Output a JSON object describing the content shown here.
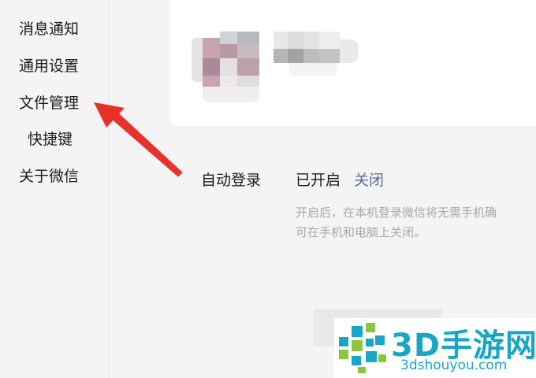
{
  "sidebar": {
    "items": [
      {
        "label": "消息通知"
      },
      {
        "label": "通用设置"
      },
      {
        "label": "文件管理"
      },
      {
        "label": "快捷键"
      },
      {
        "label": "关于微信"
      }
    ]
  },
  "settings": {
    "auto_login": {
      "label": "自动登录",
      "status": "已开启",
      "action": "关闭",
      "description_line1": "开启后，在本机登录微信将无需手机确",
      "description_line2": "可在手机和电脑上关闭。"
    }
  },
  "watermark": {
    "title": "3D手游网",
    "url": "3dshouyou.com"
  },
  "colors": {
    "arrow": "#e8312b",
    "link": "#5b6b8c",
    "watermark": "#17a7c4"
  }
}
